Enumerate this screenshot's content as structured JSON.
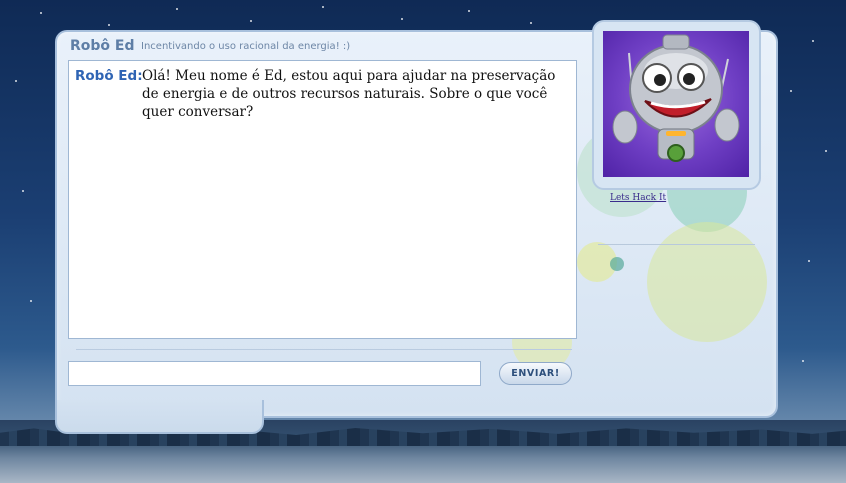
{
  "header": {
    "title": "Robô Ed",
    "subtitle": "Incentivando o uso racional da energia! :)"
  },
  "chat": {
    "messages": [
      {
        "speaker": "Robô Ed:",
        "text": "Olá! Meu nome é Ed, estou aqui para ajudar na preservação de energia e de outros recursos naturais. Sobre o que você quer conversar?"
      }
    ]
  },
  "composer": {
    "value": "",
    "placeholder": "",
    "send_label": "ENVIAR!"
  },
  "sidebar": {
    "avatar_icon": "robot-avatar",
    "link_label": "Lets Hack It"
  },
  "colors": {
    "sky_top": "#0f2a55",
    "panel_bg": "#e9f1fa",
    "speaker_blue": "#2f64b4",
    "title_blue": "#5e7ea6",
    "avatar_purple": "#6f3fc4",
    "accent_green": "#c7dd6a",
    "accent_teal": "#7fc6b4"
  }
}
